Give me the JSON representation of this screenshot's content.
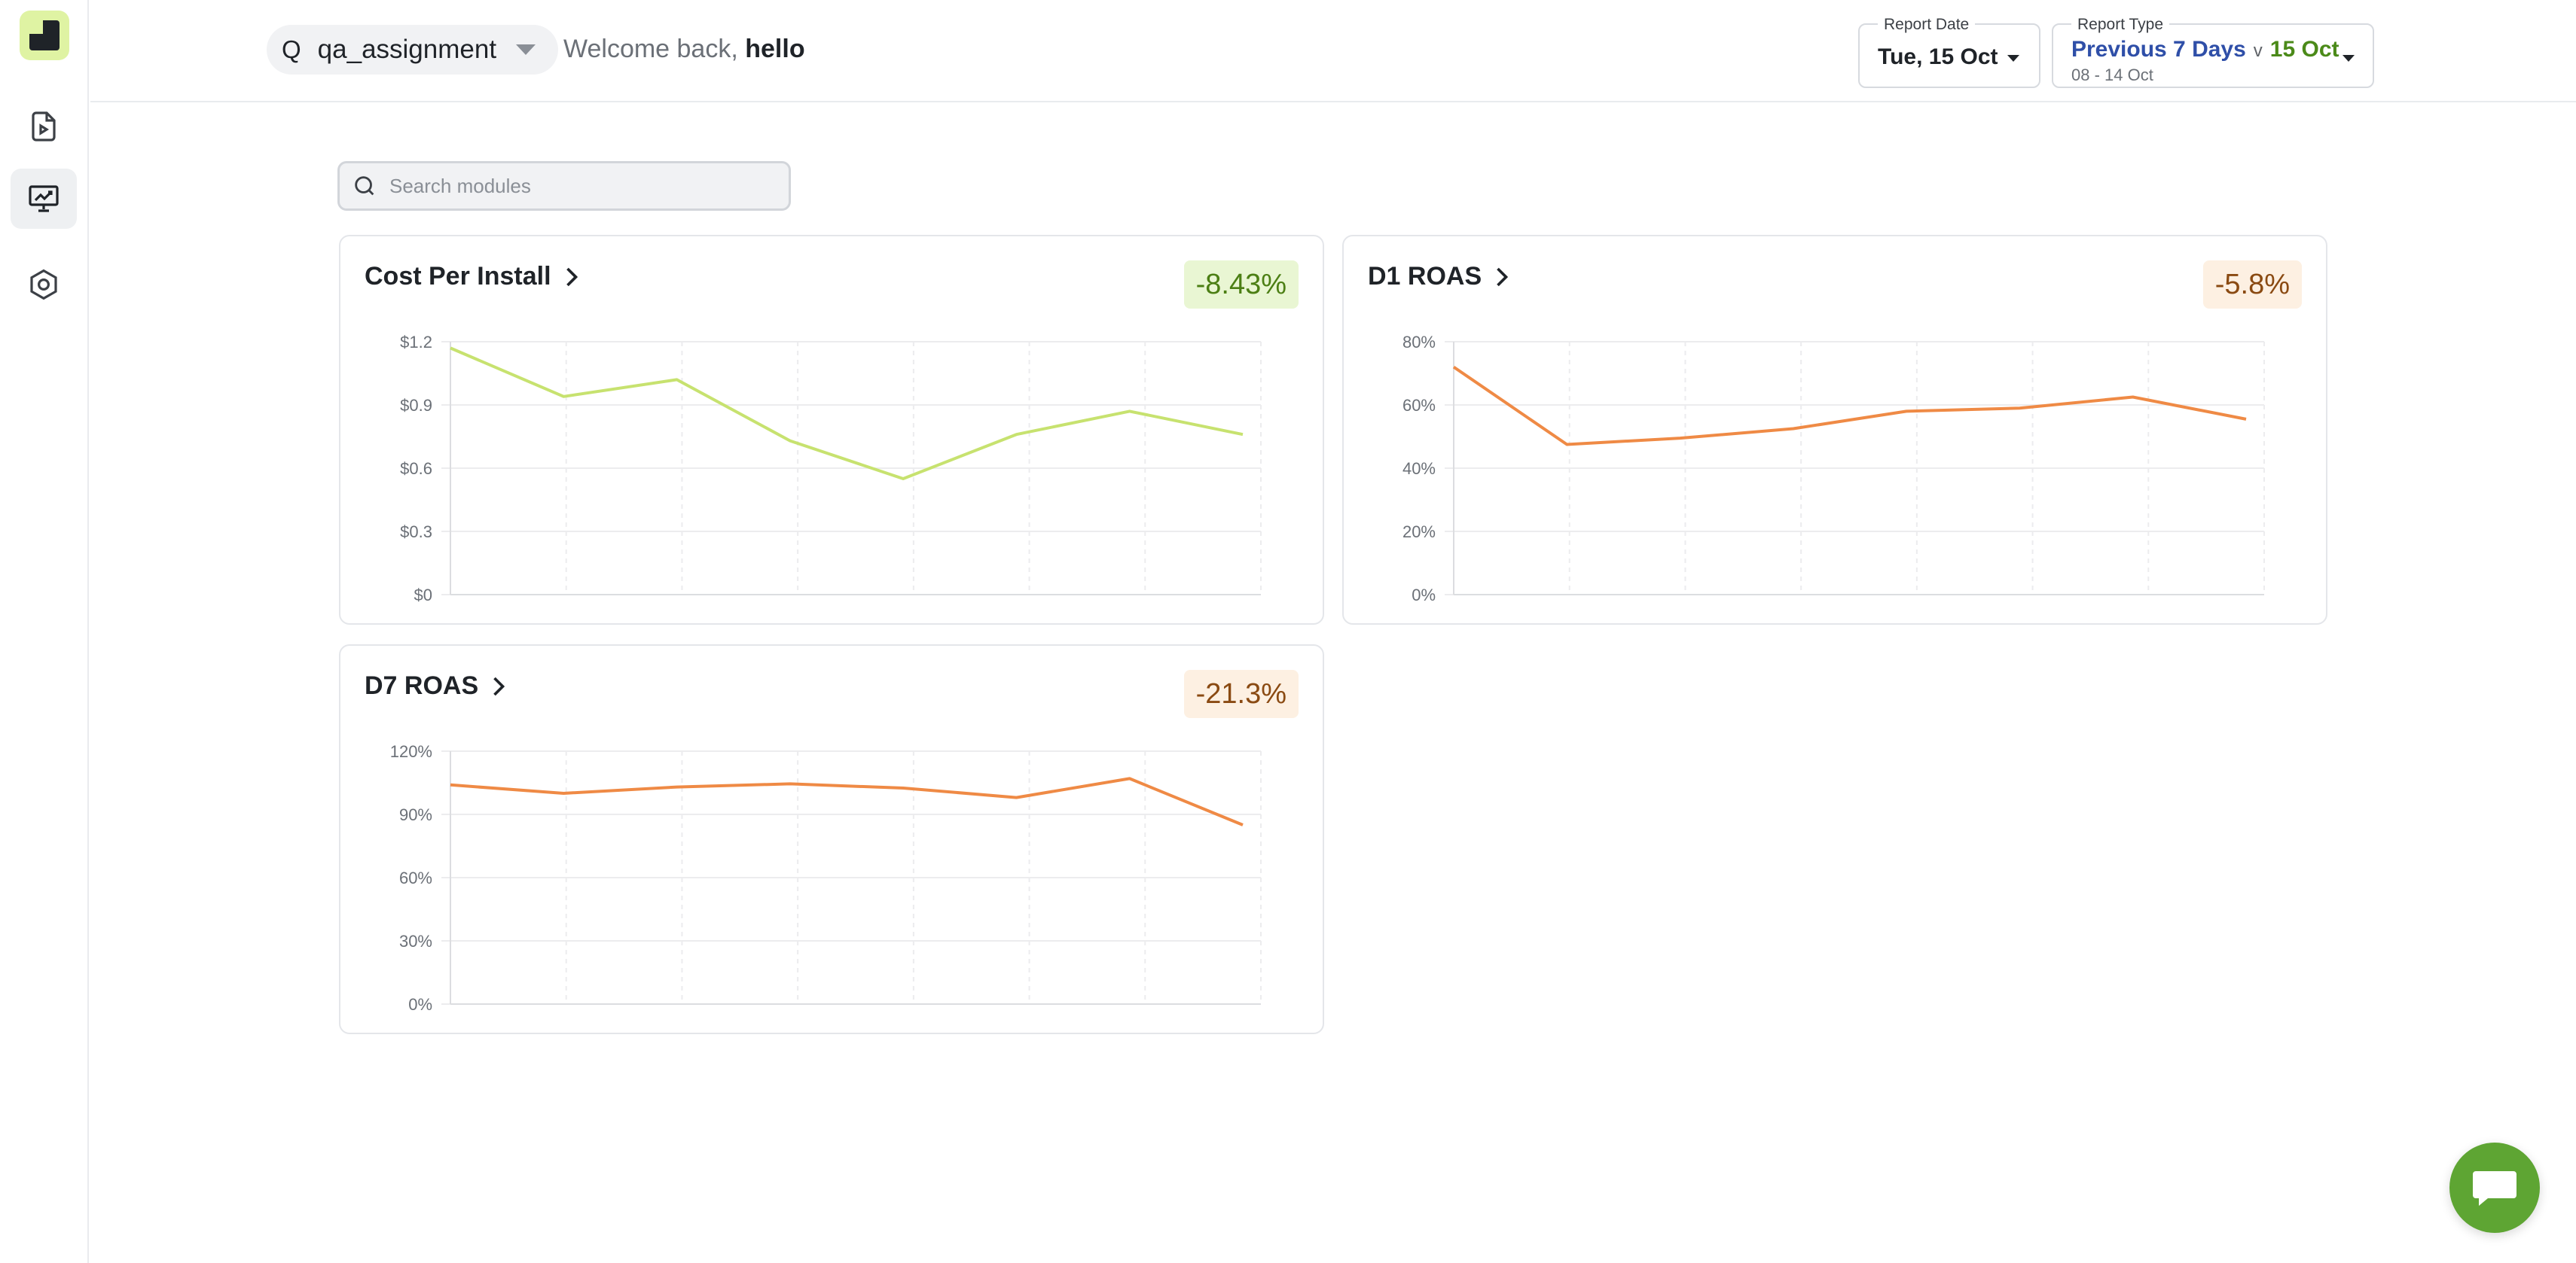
{
  "sidebar": {
    "items": [
      {
        "name": "reports",
        "icon": "video-file-icon"
      },
      {
        "name": "dashboard",
        "icon": "presentation-chart-icon",
        "active": true
      },
      {
        "name": "settings",
        "icon": "hexagon-settings-icon"
      }
    ]
  },
  "header": {
    "workspace_initial": "Q",
    "workspace_name": "qa_assignment",
    "welcome_prefix": "Welcome back, ",
    "welcome_user": "hello",
    "report_date": {
      "label": "Report Date",
      "value": "Tue, 15 Oct"
    },
    "report_type": {
      "label": "Report Type",
      "previous": "Previous 7 Days",
      "vs": "v",
      "current": "15 Oct",
      "range": "08 - 14 Oct"
    }
  },
  "search": {
    "placeholder": "Search modules"
  },
  "cards": [
    {
      "title": "Cost Per Install",
      "change": "-8.43%",
      "tone": "green"
    },
    {
      "title": "D1 ROAS",
      "change": "-5.8%",
      "tone": "orange"
    },
    {
      "title": "D7 ROAS",
      "change": "-21.3%",
      "tone": "orange"
    }
  ],
  "chart_data": [
    {
      "type": "line",
      "title": "Cost Per Install",
      "color": "#c7e26f",
      "ylim": [
        0,
        1.2
      ],
      "yticks": [
        "$0",
        "$0.3",
        "$0.6",
        "$0.9",
        "$1.2"
      ],
      "x": [
        1,
        2,
        3,
        4,
        5,
        6,
        7,
        8
      ],
      "values": [
        1.17,
        0.94,
        1.02,
        0.73,
        0.55,
        0.76,
        0.87,
        0.76
      ]
    },
    {
      "type": "line",
      "title": "D1 ROAS",
      "color": "#ef8a45",
      "ylim": [
        0,
        80
      ],
      "yticks": [
        "0%",
        "20%",
        "40%",
        "60%",
        "80%"
      ],
      "x": [
        1,
        2,
        3,
        4,
        5,
        6,
        7,
        8
      ],
      "values": [
        72,
        47.5,
        49.5,
        52.5,
        58,
        59,
        62.5,
        55.5
      ]
    },
    {
      "type": "line",
      "title": "D7 ROAS",
      "color": "#ef8a45",
      "ylim": [
        0,
        120
      ],
      "yticks": [
        "0%",
        "30%",
        "60%",
        "90%",
        "120%"
      ],
      "x": [
        1,
        2,
        3,
        4,
        5,
        6,
        7,
        8
      ],
      "values": [
        104,
        100,
        103,
        104.5,
        102.5,
        98,
        107,
        85
      ]
    }
  ],
  "colors": {
    "accent_green": "#5ea533",
    "logo_bg": "#dff3a3",
    "prev_blue": "#2f4fa8",
    "current_green": "#4b8a19"
  }
}
